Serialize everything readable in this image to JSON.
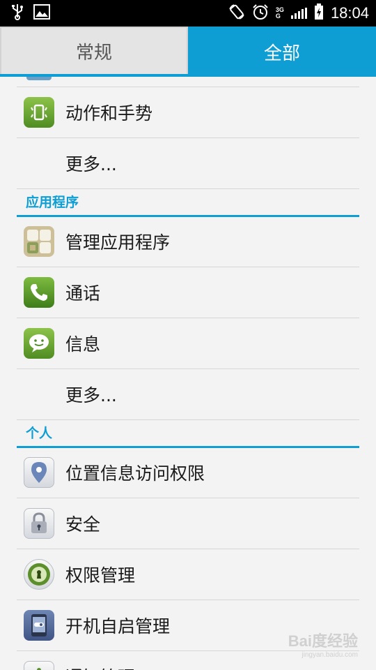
{
  "status_bar": {
    "time": "18:04",
    "network_top": "3G",
    "network_bottom": "G",
    "icons": [
      "usb-icon",
      "image-icon",
      "rotate-icon",
      "alarm-icon",
      "signal-icon",
      "battery-charging-icon"
    ]
  },
  "tabs": [
    {
      "label": "常规",
      "selected": false
    },
    {
      "label": "全部",
      "selected": true
    }
  ],
  "accent_color": "#0e9ed4",
  "list": {
    "row_gesture": {
      "label": "动作和手势",
      "icon": "gesture-icon"
    },
    "row_more_1": {
      "label": "更多..."
    },
    "section_apps": {
      "title": "应用程序"
    },
    "row_manage_apps": {
      "label": "管理应用程序",
      "icon": "apps-grid-icon"
    },
    "row_call": {
      "label": "通话",
      "icon": "phone-icon"
    },
    "row_messages": {
      "label": "信息",
      "icon": "message-icon"
    },
    "row_more_2": {
      "label": "更多..."
    },
    "section_personal": {
      "title": "个人"
    },
    "row_location": {
      "label": "位置信息访问权限",
      "icon": "location-pin-icon"
    },
    "row_security": {
      "label": "安全",
      "icon": "lock-icon"
    },
    "row_permissions": {
      "label": "权限管理",
      "icon": "keyhole-icon"
    },
    "row_autostart": {
      "label": "开机自启管理",
      "icon": "startup-phone-icon"
    },
    "row_notifications": {
      "label": "通知管理",
      "icon": "notification-icon"
    }
  },
  "watermark": {
    "text": "Bai度经验",
    "sub": "jingyan.baidu.com"
  }
}
